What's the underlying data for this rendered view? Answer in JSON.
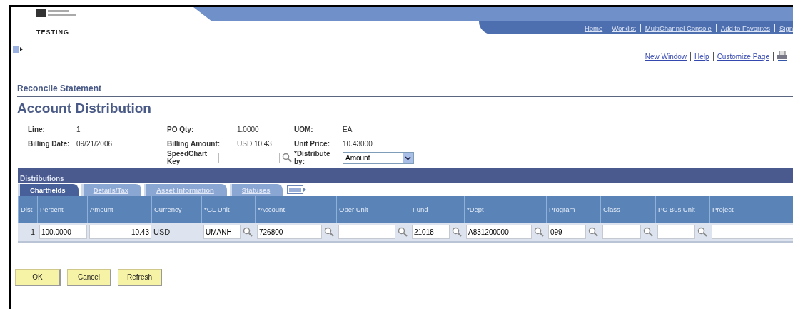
{
  "header": {
    "environment": "TESTING",
    "nav_links": [
      "Home",
      "Worklist",
      "MultiChannel Console",
      "Add to Favorites",
      "Sign"
    ],
    "page_links": [
      "New Window",
      "Help",
      "Customize Page"
    ]
  },
  "breadcrumb": "Reconcile Statement",
  "title": "Account Distribution",
  "summary_columns": [
    [
      {
        "kind": "text",
        "label": "Line:",
        "value": "1"
      },
      {
        "kind": "text",
        "label": "Billing Date:",
        "value": "09/21/2006"
      }
    ],
    [
      {
        "kind": "text",
        "label": "PO Qty:",
        "value": "1.0000"
      },
      {
        "kind": "text",
        "label": "Billing Amount:",
        "value": "USD  10.43"
      },
      {
        "kind": "lookup",
        "label": "SpeedChart Key"
      }
    ],
    [
      {
        "kind": "text",
        "label": "UOM:",
        "value": "EA"
      },
      {
        "kind": "text",
        "label": "Unit Price:",
        "value": "10.43000"
      },
      {
        "kind": "select",
        "label": "*Distribute by:",
        "value": "Amount"
      }
    ]
  ],
  "distributions": {
    "title": "Distributions",
    "tabs": [
      {
        "label": "Chartfields",
        "selected": true
      },
      {
        "label": "Details/Tax",
        "selected": false
      },
      {
        "label": "Asset Information",
        "selected": false
      },
      {
        "label": "Statuses",
        "selected": false
      }
    ],
    "columns": [
      "Dist",
      "Percent",
      "Amount",
      "Currency",
      "*GL Unit",
      "*Account",
      "Oper Unit",
      "Fund",
      "*Dept",
      "Program",
      "Class",
      "PC Bus Unit",
      "Project"
    ],
    "rows": [
      [
        {
          "kind": "text",
          "value": "1"
        },
        {
          "kind": "input",
          "value": "100.0000"
        },
        {
          "kind": "input",
          "value": "10.43"
        },
        {
          "kind": "text",
          "value": "USD"
        },
        {
          "kind": "lookup",
          "value": "UMANH"
        },
        {
          "kind": "lookup",
          "value": "726800"
        },
        {
          "kind": "lookup"
        },
        {
          "kind": "lookup",
          "value": "21018"
        },
        {
          "kind": "lookup",
          "value": "A831200000"
        },
        {
          "kind": "lookup",
          "value": "099"
        },
        {
          "kind": "lookup"
        },
        {
          "kind": "lookup"
        },
        {
          "kind": "input"
        }
      ]
    ]
  },
  "buttons": [
    "OK",
    "Cancel",
    "Refresh"
  ]
}
